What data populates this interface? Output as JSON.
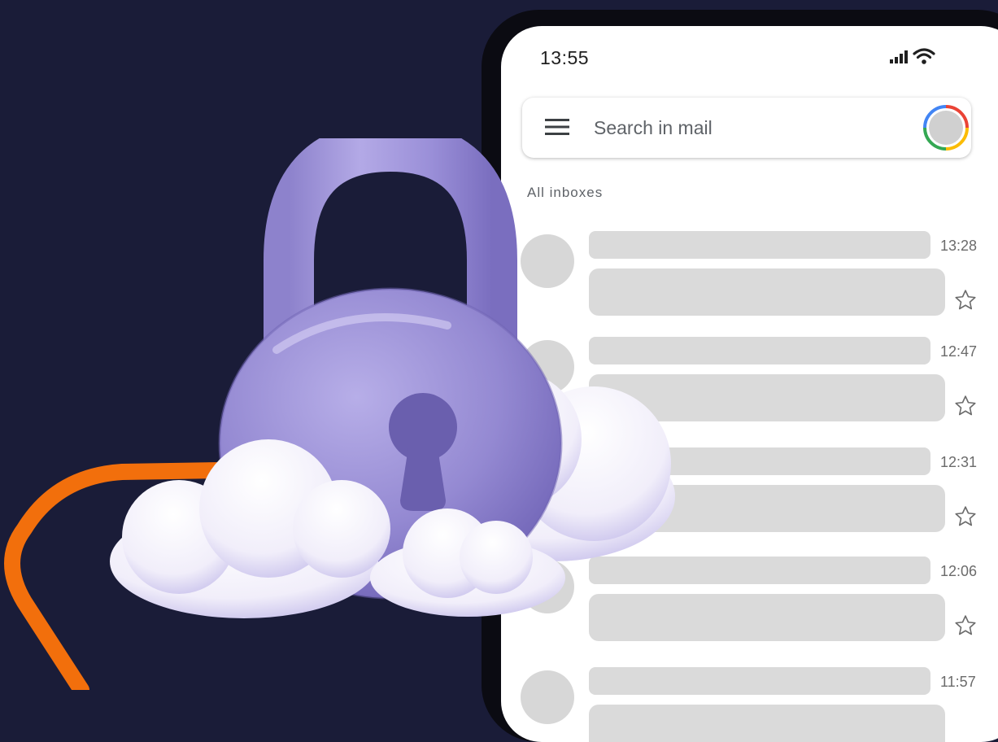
{
  "status_bar": {
    "time": "13:55"
  },
  "search": {
    "placeholder": "Search in mail"
  },
  "section": {
    "label": "All inboxes"
  },
  "mails": [
    {
      "time": "13:28"
    },
    {
      "time": "12:47"
    },
    {
      "time": "12:31"
    },
    {
      "time": "12:06"
    },
    {
      "time": "11:57"
    }
  ],
  "colors": {
    "background": "#1a1c38",
    "accent_orange": "#f26f0c",
    "lock_purple": "#9b90d6",
    "placeholder_gray": "#dadada"
  },
  "icons": [
    "signal-icon",
    "wifi-icon",
    "menu-icon",
    "avatar",
    "star-icon",
    "padlock-illustration",
    "cloud-illustration"
  ]
}
